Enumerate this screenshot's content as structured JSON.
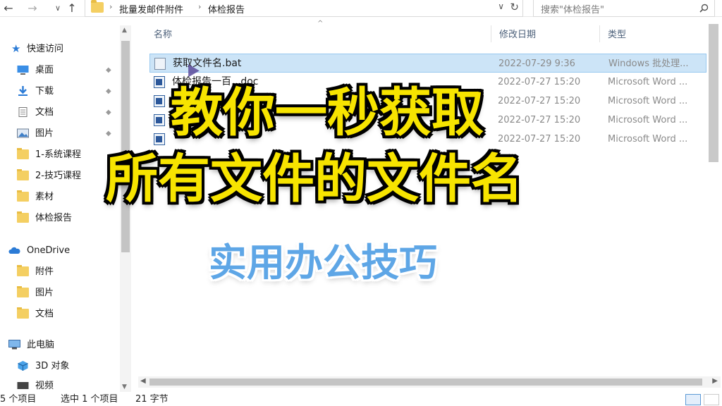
{
  "address": {
    "nav_back": "←",
    "nav_forward": "→",
    "nav_recent": "∨",
    "nav_up": "↑",
    "crumbs": [
      "批量发邮件附件",
      "体检报告"
    ],
    "dropdown": "∨",
    "refresh": "↻",
    "search_placeholder": "搜索\"体检报告\""
  },
  "sidebar": {
    "quick_access": "快速访问",
    "items": [
      {
        "label": "桌面",
        "icon": "desktop-icon",
        "pinned": true
      },
      {
        "label": "下载",
        "icon": "download-icon",
        "pinned": true
      },
      {
        "label": "文档",
        "icon": "document-icon",
        "pinned": true
      },
      {
        "label": "图片",
        "icon": "picture-icon",
        "pinned": true
      },
      {
        "label": "1-系统课程",
        "icon": "folder-icon",
        "pinned": false
      },
      {
        "label": "2-技巧课程",
        "icon": "folder-icon",
        "pinned": false
      },
      {
        "label": "素材",
        "icon": "folder-icon",
        "pinned": false
      },
      {
        "label": "体检报告",
        "icon": "folder-icon",
        "pinned": false
      }
    ],
    "onedrive": "OneDrive",
    "onedrive_items": [
      "附件",
      "图片",
      "文档"
    ],
    "this_pc": "此电脑",
    "pc_items": [
      "3D 对象",
      "视频"
    ],
    "pin_glyph": "📌"
  },
  "columns": {
    "name": "名称",
    "date": "修改日期",
    "type": "类型",
    "sort_caret": "^"
  },
  "files": [
    {
      "name": "获取文件名.bat",
      "date": "2022-07-29 9:36",
      "type": "Windows 批处理...",
      "selected": true,
      "kind": "bat"
    },
    {
      "name": "体检报告一百...doc",
      "date": "2022-07-27 15:20",
      "type": "Microsoft Word ...",
      "selected": false,
      "kind": "word"
    },
    {
      "name": "",
      "date": "2022-07-27 15:20",
      "type": "Microsoft Word ...",
      "selected": false,
      "kind": "word"
    },
    {
      "name": "",
      "date": "2022-07-27 15:20",
      "type": "Microsoft Word ...",
      "selected": false,
      "kind": "word"
    },
    {
      "name": "",
      "date": "2022-07-27 15:20",
      "type": "Microsoft Word ...",
      "selected": false,
      "kind": "word"
    }
  ],
  "status": {
    "count": "5 个项目",
    "selected": "选中 1 个项目",
    "size": "21 字节"
  },
  "overlay": {
    "line1": "教你一秒获取",
    "line2": "所有文件的文件名",
    "subtitle": "实用办公技巧"
  }
}
